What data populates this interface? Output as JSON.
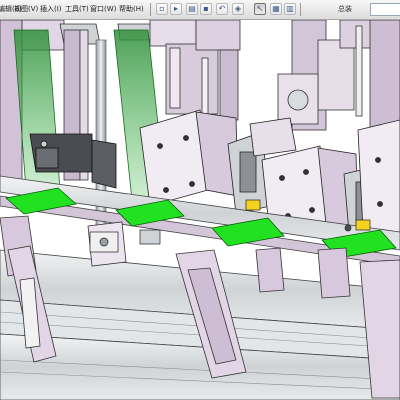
{
  "menu": {
    "items": [
      {
        "label": "编辑(E)"
      },
      {
        "label": "视图(V)"
      },
      {
        "label": "插入(I)"
      },
      {
        "label": "工具(T)"
      },
      {
        "label": "窗口(W)"
      },
      {
        "label": "帮助(H)"
      }
    ],
    "document_tab": "总装"
  },
  "toolbar": {
    "icons": [
      "new-icon",
      "open-icon",
      "print-icon",
      "undo-icon",
      "select-icon",
      "rebuild-icon",
      "options-icon"
    ]
  },
  "viewport": {
    "description_name": "3D assembly model view",
    "colors": {
      "background": "#ffffff",
      "frame_lavender": "#d7c6dc",
      "frame_light": "#ece4ee",
      "aluminum": "#d9dcdf",
      "pcb_green": "#21e121",
      "sensor_beam": "#3fb84a",
      "dark_block": "#4a4c52"
    }
  }
}
